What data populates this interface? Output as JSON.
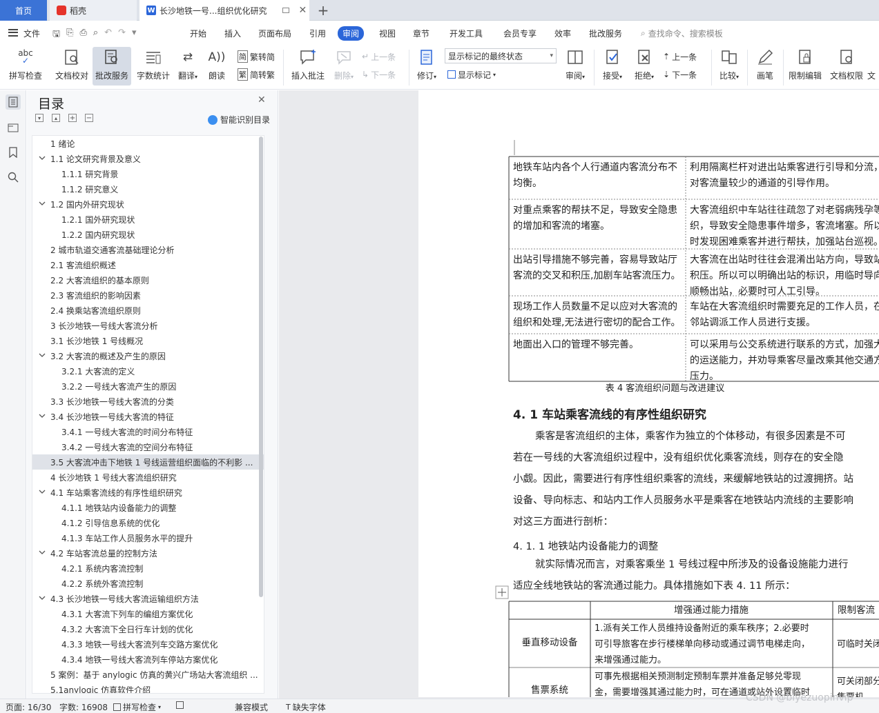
{
  "tabs": {
    "home": "首页",
    "daoke": "稻壳",
    "doc": "长沙地铁一号...组织优化研究",
    "new_tab": "+"
  },
  "menu": {
    "file": "文件",
    "items": [
      "开始",
      "插入",
      "页面布局",
      "引用",
      "审阅",
      "视图",
      "章节",
      "开发工具",
      "会员专享",
      "效率",
      "批改服务"
    ],
    "active": "审阅",
    "search_placeholder": "查找命令、搜索模板"
  },
  "ribbon": {
    "spell": "拼写检查",
    "doc_check": "文档校对",
    "correct": "批改服务",
    "word_count": "字数统计",
    "translate": "翻译",
    "read_aloud": "朗读",
    "trad": "繁转简",
    "simp": "简转繁",
    "insert_comment": "插入批注",
    "delete": "删除",
    "prev": "上一条",
    "next": "下一条",
    "revise": "修订",
    "markup_state": "显示标记的最终状态",
    "show_markup": "显示标记",
    "review": "审阅",
    "accept": "接受",
    "reject": "拒绝",
    "prev2": "上一条",
    "next2": "下一条",
    "compare": "比较",
    "pen": "画笔",
    "restrict": "限制编辑",
    "doc_perm": "文档权限",
    "cut": "文"
  },
  "toc": {
    "title": "目录",
    "smart": "智能识别目录",
    "items": [
      {
        "label": "1  绪论",
        "level": 1,
        "chevron": false
      },
      {
        "label": "1.1  论文研究背景及意义",
        "level": 1,
        "chevron": true
      },
      {
        "label": "1.1.1  研究背景",
        "level": 2,
        "chevron": false
      },
      {
        "label": "1.1.2 研究意义",
        "level": 2,
        "chevron": false
      },
      {
        "label": "1.2 国内外研究现状",
        "level": 1,
        "chevron": true
      },
      {
        "label": "1.2.1 国外研究现状",
        "level": 2,
        "chevron": false
      },
      {
        "label": "1.2.2 国内研究现状",
        "level": 2,
        "chevron": false
      },
      {
        "label": "2  城市轨道交通客流基础理论分析",
        "level": 1,
        "chevron": false
      },
      {
        "label": "2.1 客流组织概述",
        "level": 1,
        "chevron": false
      },
      {
        "label": "2.2 大客流组织的基本原则",
        "level": 1,
        "chevron": false
      },
      {
        "label": "2.3 客流组织的影响因素",
        "level": 1,
        "chevron": false
      },
      {
        "label": "2.4 换乘站客流组织原则",
        "level": 1,
        "chevron": false
      },
      {
        "label": "3 长沙地铁一号线大客流分析",
        "level": 1,
        "chevron": false
      },
      {
        "label": "3.1 长沙地铁 1 号线概况",
        "level": 1,
        "chevron": false
      },
      {
        "label": "3.2 大客流的概述及产生的原因",
        "level": 1,
        "chevron": true
      },
      {
        "label": "3.2.1 大客流的定义",
        "level": 2,
        "chevron": false
      },
      {
        "label": "3.2.2 一号线大客流产生的原因",
        "level": 2,
        "chevron": false
      },
      {
        "label": "3.3 长沙地铁一号线大客流的分类",
        "level": 1,
        "chevron": false
      },
      {
        "label": "3.4 长沙地铁一号线大客流的特征",
        "level": 1,
        "chevron": true
      },
      {
        "label": "3.4.1 一号线大客流的时间分布特征",
        "level": 2,
        "chevron": false
      },
      {
        "label": "3.4.2 一号线大客流的空间分布特征",
        "level": 2,
        "chevron": false
      },
      {
        "label": "3.5 大客流冲击下地铁 1 号线运营组织面临的不利影 ...",
        "level": 1,
        "chevron": false,
        "active": true
      },
      {
        "label": "4 长沙地铁 1 号线大客流组织研究",
        "level": 1,
        "chevron": false
      },
      {
        "label": "4.1 车站乘客流线的有序性组织研究",
        "level": 1,
        "chevron": true
      },
      {
        "label": "4.1.1 地铁站内设备能力的调整",
        "level": 2,
        "chevron": false
      },
      {
        "label": "4.1.2 引导信息系统的优化",
        "level": 2,
        "chevron": false
      },
      {
        "label": "4.1.3 车站工作人员服务水平的提升",
        "level": 2,
        "chevron": false
      },
      {
        "label": "4.2 车站客流总量的控制方法",
        "level": 1,
        "chevron": true
      },
      {
        "label": "4.2.1 系统内客流控制",
        "level": 2,
        "chevron": false
      },
      {
        "label": "4.2.2 系统外客流控制",
        "level": 2,
        "chevron": false
      },
      {
        "label": "4.3 长沙地铁一号线大客流运输组织方法",
        "level": 1,
        "chevron": true
      },
      {
        "label": "4.3.1 大客流下列车的编组方案优化",
        "level": 2,
        "chevron": false
      },
      {
        "label": "4.3.2 大客流下全日行车计划的优化",
        "level": 2,
        "chevron": false
      },
      {
        "label": "4.3.3 地铁一号线大客流列车交路方案优化",
        "level": 2,
        "chevron": false
      },
      {
        "label": "4.3.4 地铁一号线大客流列车停站方案优化",
        "level": 2,
        "chevron": false
      },
      {
        "label": "5 案例：基于 anylogic 仿真的黄兴广场站大客流组织 ...",
        "level": 1,
        "chevron": false
      },
      {
        "label": "5.1anylogic 仿真软件介绍",
        "level": 1,
        "chevron": false
      }
    ]
  },
  "doc": {
    "table1": [
      {
        "left": [
          "地铁车站内各个人行通道内客流分布不",
          "均衡。"
        ],
        "right": [
          "利用隔离栏杆对进出站乘客进行引导和分流，",
          "对客流量较少的通道的引导作用。"
        ]
      },
      {
        "left": [
          "对重点乘客的帮扶不足，导致安全隐患",
          "的增加和客流的堵塞。"
        ],
        "right": [
          "大客流组织中车站往往疏忽了对老弱病残孕等",
          "织，导致安全隐患事件增多，客流堵塞。所以",
          "时发现困难乘客并进行帮扶，加强站台巡视。"
        ]
      },
      {
        "left": [
          "出站引导措施不够完善，容易导致站厅",
          "客流的交叉和积压,加剧车站客流压力。"
        ],
        "right": [
          "大客流在出站时往往会混淆出站方向，导致站",
          "积压。所以可以明确出站的标识，用临时导向",
          "顺畅出站，必要时可人工引导。"
        ]
      },
      {
        "left": [
          "现场工作人员数量不足以应对大客流的",
          "组织和处理,无法进行密切的配合工作。"
        ],
        "right": [
          "车站在大客流组织时需要充足的工作人员，在",
          "邻站调派工作人员进行支援。"
        ]
      },
      {
        "left": [
          "地面出入口的管理不够完善。"
        ],
        "right": [
          "可以采用与公交系统进行联系的方式，加强大",
          "的运送能力，并劝导乘客尽量改乘其他交通方",
          "压力。"
        ]
      }
    ],
    "table1_caption": "表 4 客流组织问题与改进建议",
    "heading": "4. 1 车站乘客流线的有序性组织研究",
    "para1": [
      "乘客是客流组织的主体，乘客作为独立的个体移动，有很多因素是不可",
      "若在一号线的大客流组织过程中，没有组织优化乘客流线，则存在的安全隐",
      "小觑。因此，需要进行有序性组织乘客的流线，来缓解地铁站的过渡拥挤。站",
      "设备、导向标志、和站内工作人员服务水平是乘客在地铁站内流线的主要影响",
      "对这三方面进行剖析："
    ],
    "subheading": "4. 1. 1 地铁站内设备能力的调整",
    "para2": [
      "就实际情况而言，对乘客乘坐 1 号线过程中所涉及的设备设施能力进行",
      "适应全线地铁站的客流通过能力。具体措施如下表 4. 11 所示："
    ],
    "table2_headers": [
      "增强通过能力措施",
      "限制客流"
    ],
    "table2_rows": [
      {
        "label": "垂直移动设备",
        "measure": [
          "1.派有关工作人员维持设备附近的乘车秩序；2.必要时",
          "可引导旅客在步行楼梯单向移动或通过调节电梯走向，",
          "来增强通过能力。"
        ],
        "limit": [
          "可临时关闭"
        ]
      },
      {
        "label": "售票系统",
        "measure": [
          "可事先根据相关预测制定预制车票并准备足够兑零现",
          "金，需要增强其通过能力时，可在通道或站外设置临时"
        ],
        "limit": [
          "可关闭部分",
          "售票机"
        ]
      }
    ]
  },
  "status": {
    "page": "页面: 16/30",
    "words": "字数: 16908",
    "spell": "拼写检查",
    "proof": "文档校对",
    "compat": "兼容模式",
    "missing_font": "缺失字体",
    "watermark": "CSDN @biyezuopinvip"
  },
  "colors": {
    "accent": "#2b66d9",
    "tabActive": "#3b73d6",
    "daoke": "#e5332a"
  }
}
